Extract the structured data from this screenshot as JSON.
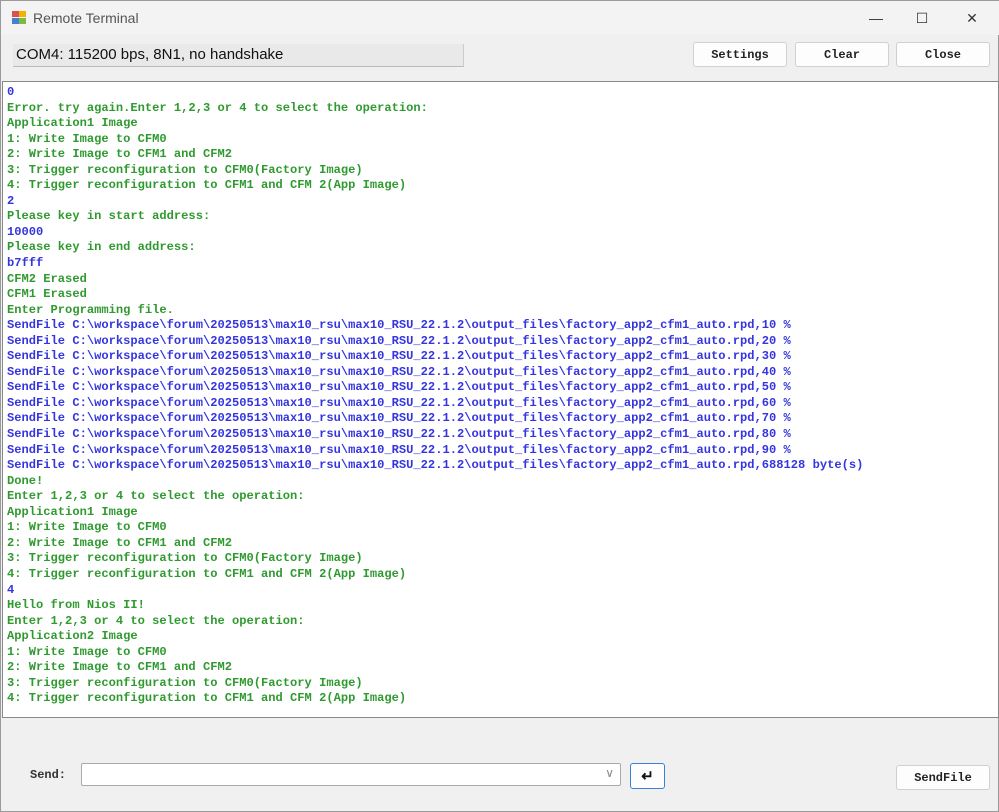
{
  "window": {
    "title": "Remote Terminal",
    "minimize": "—",
    "maximize": "☐",
    "close": "✕"
  },
  "status": "COM4: 115200 bps, 8N1, no handshake",
  "toolbar": {
    "settings": "Settings",
    "clear": "Clear",
    "close": "Close"
  },
  "colors": {
    "input": "#3535e0",
    "output": "#2f9a2f"
  },
  "terminal": [
    {
      "t": "in",
      "text": "0"
    },
    {
      "t": "out",
      "text": "Error. try again.Enter 1,2,3 or 4 to select the operation:"
    },
    {
      "t": "out",
      "text": "Application1 Image"
    },
    {
      "t": "out",
      "text": "1: Write Image to CFM0"
    },
    {
      "t": "out",
      "text": "2: Write Image to CFM1 and CFM2"
    },
    {
      "t": "out",
      "text": "3: Trigger reconfiguration to CFM0(Factory Image)"
    },
    {
      "t": "out",
      "text": "4: Trigger reconfiguration to CFM1 and CFM 2(App Image)"
    },
    {
      "t": "in",
      "text": "2"
    },
    {
      "t": "out",
      "text": "Please key in start address:"
    },
    {
      "t": "in",
      "text": "10000"
    },
    {
      "t": "out",
      "text": "Please key in end address:"
    },
    {
      "t": "in",
      "text": "b7fff"
    },
    {
      "t": "out",
      "text": "CFM2 Erased"
    },
    {
      "t": "out",
      "text": "CFM1 Erased"
    },
    {
      "t": "out",
      "text": "Enter Programming file."
    },
    {
      "t": "in",
      "text": "SendFile C:\\workspace\\forum\\20250513\\max10_rsu\\max10_RSU_22.1.2\\output_files\\factory_app2_cfm1_auto.rpd,10 %"
    },
    {
      "t": "in",
      "text": "SendFile C:\\workspace\\forum\\20250513\\max10_rsu\\max10_RSU_22.1.2\\output_files\\factory_app2_cfm1_auto.rpd,20 %"
    },
    {
      "t": "in",
      "text": "SendFile C:\\workspace\\forum\\20250513\\max10_rsu\\max10_RSU_22.1.2\\output_files\\factory_app2_cfm1_auto.rpd,30 %"
    },
    {
      "t": "in",
      "text": "SendFile C:\\workspace\\forum\\20250513\\max10_rsu\\max10_RSU_22.1.2\\output_files\\factory_app2_cfm1_auto.rpd,40 %"
    },
    {
      "t": "in",
      "text": "SendFile C:\\workspace\\forum\\20250513\\max10_rsu\\max10_RSU_22.1.2\\output_files\\factory_app2_cfm1_auto.rpd,50 %"
    },
    {
      "t": "in",
      "text": "SendFile C:\\workspace\\forum\\20250513\\max10_rsu\\max10_RSU_22.1.2\\output_files\\factory_app2_cfm1_auto.rpd,60 %"
    },
    {
      "t": "in",
      "text": "SendFile C:\\workspace\\forum\\20250513\\max10_rsu\\max10_RSU_22.1.2\\output_files\\factory_app2_cfm1_auto.rpd,70 %"
    },
    {
      "t": "in",
      "text": "SendFile C:\\workspace\\forum\\20250513\\max10_rsu\\max10_RSU_22.1.2\\output_files\\factory_app2_cfm1_auto.rpd,80 %"
    },
    {
      "t": "in",
      "text": "SendFile C:\\workspace\\forum\\20250513\\max10_rsu\\max10_RSU_22.1.2\\output_files\\factory_app2_cfm1_auto.rpd,90 %"
    },
    {
      "t": "in",
      "text": "SendFile C:\\workspace\\forum\\20250513\\max10_rsu\\max10_RSU_22.1.2\\output_files\\factory_app2_cfm1_auto.rpd,688128 byte(s)"
    },
    {
      "t": "out",
      "text": "Done!"
    },
    {
      "t": "out",
      "text": "Enter 1,2,3 or 4 to select the operation:"
    },
    {
      "t": "out",
      "text": "Application1 Image"
    },
    {
      "t": "out",
      "text": "1: Write Image to CFM0"
    },
    {
      "t": "out",
      "text": "2: Write Image to CFM1 and CFM2"
    },
    {
      "t": "out",
      "text": "3: Trigger reconfiguration to CFM0(Factory Image)"
    },
    {
      "t": "out",
      "text": "4: Trigger reconfiguration to CFM1 and CFM 2(App Image)"
    },
    {
      "t": "in",
      "text": "4"
    },
    {
      "t": "out",
      "text": "Hello from Nios II!"
    },
    {
      "t": "out",
      "text": "Enter 1,2,3 or 4 to select the operation:"
    },
    {
      "t": "out",
      "text": "Application2 Image"
    },
    {
      "t": "out",
      "text": "1: Write Image to CFM0"
    },
    {
      "t": "out",
      "text": "2: Write Image to CFM1 and CFM2"
    },
    {
      "t": "out",
      "text": "3: Trigger reconfiguration to CFM0(Factory Image)"
    },
    {
      "t": "out",
      "text": "4: Trigger reconfiguration to CFM1 and CFM 2(App Image)"
    }
  ],
  "send": {
    "label": "Send:",
    "value": "",
    "chevron": "∨",
    "enter": "↵",
    "sendfile": "SendFile"
  }
}
